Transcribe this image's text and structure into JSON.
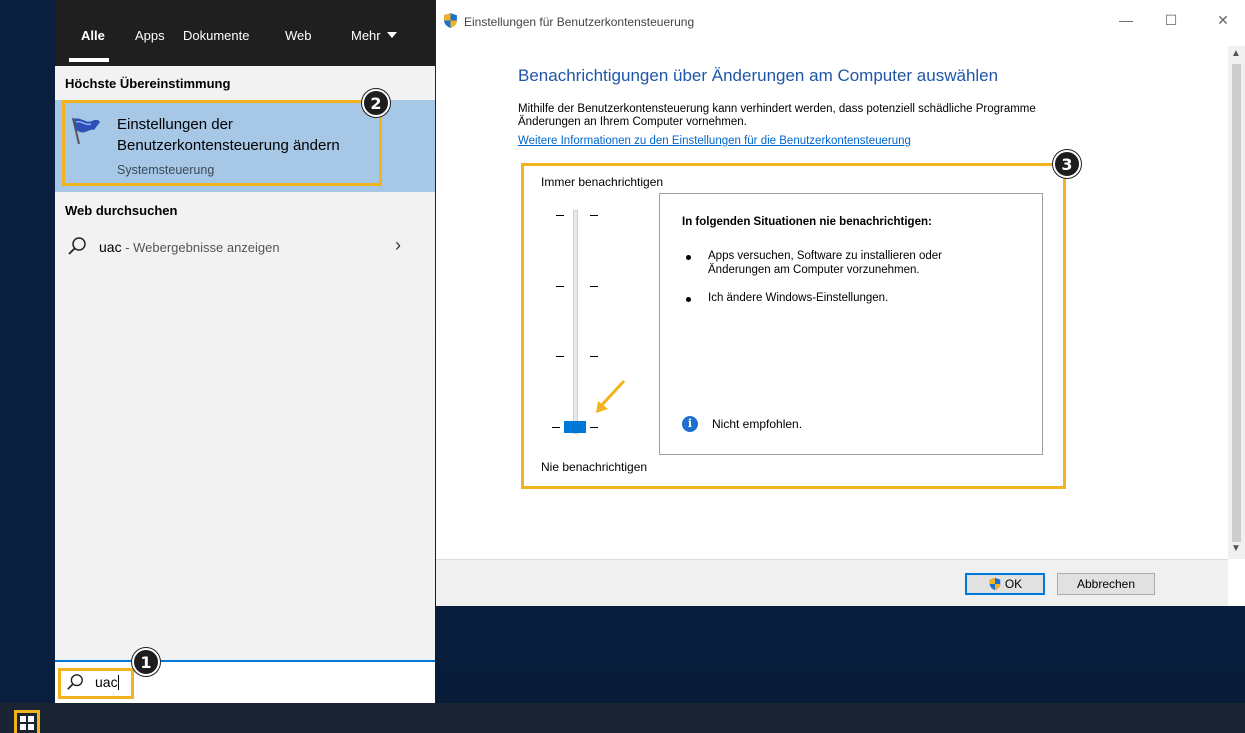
{
  "start_menu": {
    "tabs": [
      "Alle",
      "Apps",
      "Dokumente",
      "Web",
      "Mehr"
    ],
    "best_match_header": "Höchste Übereinstimmung",
    "best_match": {
      "title_line1": "Einstellungen der",
      "title_line2": "Benutzerkontensteuerung ändern",
      "subtitle": "Systemsteuerung"
    },
    "web_search_header": "Web durchsuchen",
    "web_result": {
      "query": "uac",
      "suffix": " - Webergebnisse anzeigen"
    },
    "search_value": "uac"
  },
  "badges": [
    "1",
    "2",
    "3"
  ],
  "uac_window": {
    "title": "Einstellungen für Benutzerkontensteuerung",
    "heading": "Benachrichtigungen über Änderungen am Computer auswählen",
    "description_line1": "Mithilfe der Benutzerkontensteuerung kann verhindert werden, dass potenziell schädliche Programme",
    "description_line2": "Änderungen an Ihrem Computer vornehmen.",
    "link": "Weitere Informationen zu den Einstellungen für die Benutzerkontensteuerung",
    "slider_top_label": "Immer benachrichtigen",
    "slider_bottom_label": "Nie benachrichtigen",
    "slider_level": 0,
    "slider_levels_total": 4,
    "info_title": "In folgenden Situationen nie benachrichtigen:",
    "info_bullet1_line1": "Apps versuchen, Software zu installieren oder",
    "info_bullet1_line2": "Änderungen am Computer vorzunehmen.",
    "info_bullet2": "Ich ändere Windows-Einstellungen.",
    "info_note": "Nicht empfohlen.",
    "ok_label": "OK",
    "cancel_label": "Abbrechen"
  },
  "colors": {
    "highlight": "#f2b41e",
    "accent": "#0078d7",
    "heading_blue": "#1f56a8",
    "best_match_bg": "#a6c8e6"
  }
}
